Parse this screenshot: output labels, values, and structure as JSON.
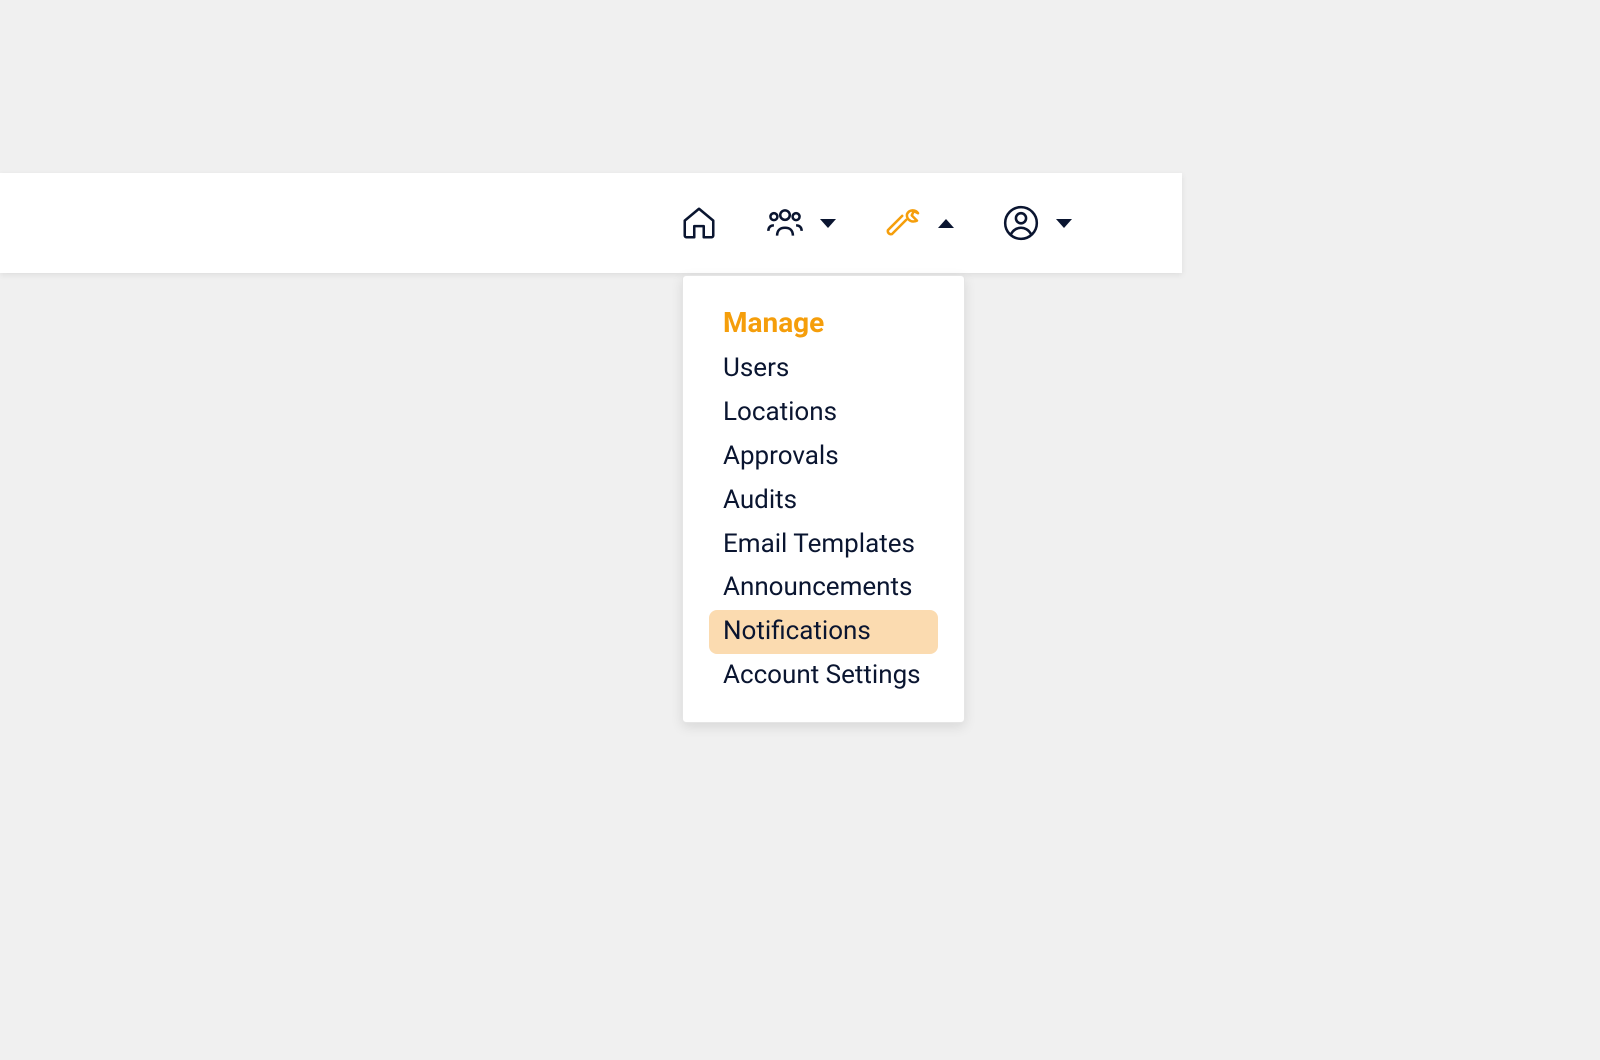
{
  "navbar": {
    "items": [
      {
        "icon": "home",
        "hasDropdown": false,
        "active": false
      },
      {
        "icon": "people",
        "hasDropdown": true,
        "open": false,
        "active": false
      },
      {
        "icon": "wrench",
        "hasDropdown": true,
        "open": true,
        "active": true
      },
      {
        "icon": "user",
        "hasDropdown": true,
        "open": false,
        "active": false
      }
    ]
  },
  "dropdown": {
    "header": "Manage",
    "items": [
      {
        "label": "Users",
        "highlighted": false
      },
      {
        "label": "Locations",
        "highlighted": false
      },
      {
        "label": "Approvals",
        "highlighted": false
      },
      {
        "label": "Audits",
        "highlighted": false
      },
      {
        "label": "Email Templates",
        "highlighted": false
      },
      {
        "label": "Announcements",
        "highlighted": false
      },
      {
        "label": "Notifications",
        "highlighted": true
      },
      {
        "label": "Account Settings",
        "highlighted": false
      }
    ]
  },
  "colors": {
    "accent": "#f59e0b",
    "highlight": "#fbdbb0",
    "text": "#0a1530",
    "background": "#f0f0f0"
  }
}
